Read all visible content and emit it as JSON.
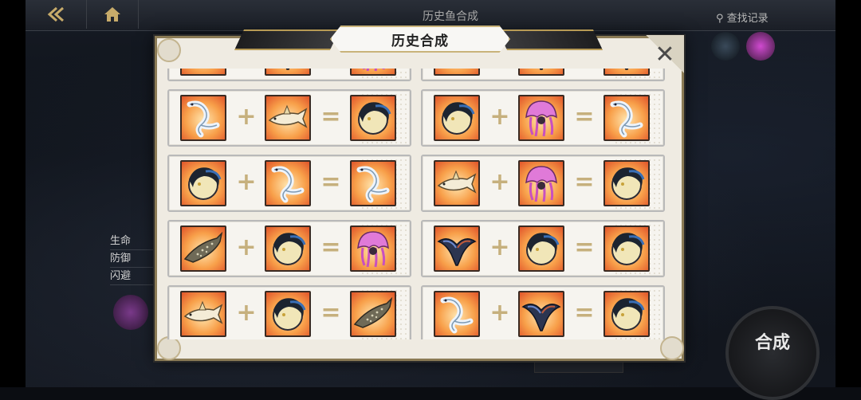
{
  "background": {
    "title": "历史鱼合成",
    "search_label": "查找记录",
    "stats": [
      "生命",
      "防御",
      "闪避"
    ],
    "merge_button_label": "合成",
    "icons": {
      "back": "back-icon",
      "home": "home-icon",
      "search": "search-icon"
    }
  },
  "modal": {
    "title": "历史合成",
    "close_glyph": "✕",
    "plus": "+",
    "equals": "=",
    "fish_types": {
      "whaleshark": "Spotted whale shark",
      "shark": "Cream shark",
      "dragon": "White sea dragon",
      "moon": "Dark moon fish",
      "jelly": "Pink jellyfish",
      "manta": "Blue manta"
    },
    "records": [
      {
        "a": "whaleshark",
        "b": "manta",
        "result": "jelly"
      },
      {
        "a": "shark",
        "b": "manta",
        "result": "manta"
      },
      {
        "a": "dragon",
        "b": "shark",
        "result": "moon"
      },
      {
        "a": "moon",
        "b": "jelly",
        "result": "dragon"
      },
      {
        "a": "moon",
        "b": "dragon",
        "result": "dragon"
      },
      {
        "a": "shark",
        "b": "jelly",
        "result": "moon"
      },
      {
        "a": "whaleshark",
        "b": "moon",
        "result": "jelly"
      },
      {
        "a": "manta",
        "b": "moon",
        "result": "moon"
      },
      {
        "a": "shark",
        "b": "moon",
        "result": "whaleshark"
      },
      {
        "a": "dragon",
        "b": "manta",
        "result": "moon"
      }
    ]
  }
}
